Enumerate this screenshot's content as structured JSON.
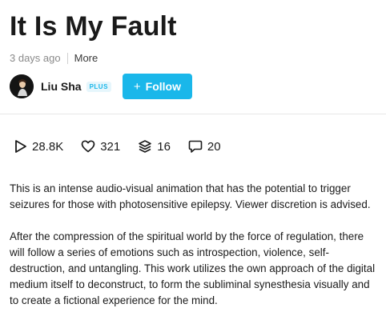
{
  "video": {
    "title": "It Is My Fault",
    "posted": "3 days ago",
    "more_label": "More"
  },
  "author": {
    "name": "Liu Sha",
    "badge": "PLUS",
    "follow_label": "Follow"
  },
  "stats": {
    "plays": "28.8K",
    "likes": "321",
    "collections": "16",
    "comments": "20"
  },
  "description": {
    "paragraph1": "This is an intense audio-visual animation that has the potential to trigger seizures for those with photosensitive epilepsy. Viewer discretion is advised.",
    "paragraph2": "After the compression of the spiritual world by the force of regulation, there will follow a series of emotions such as introspection, violence, self-destruction, and untangling. This work utilizes the own approach of the digital medium itself to deconstruct, to form the subliminal synesthesia visually and to create a fictional experience for the mind."
  },
  "colors": {
    "accent": "#1ab7ea",
    "text": "#1a1a1a",
    "muted": "#8a8a8a"
  },
  "icons": [
    "play-icon",
    "heart-icon",
    "layers-icon",
    "comment-icon",
    "plus-icon"
  ]
}
